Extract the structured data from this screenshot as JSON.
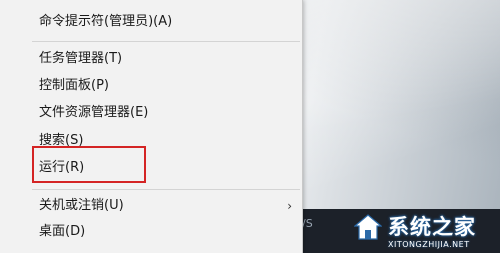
{
  "menu": {
    "items": [
      {
        "label": "命令提示符(管理员)(A)"
      },
      {
        "label": "任务管理器(T)"
      },
      {
        "label": "控制面板(P)"
      },
      {
        "label": "文件资源管理器(E)"
      },
      {
        "label": "搜索(S)"
      },
      {
        "label": "运行(R)"
      },
      {
        "label": "关机或注销(U)",
        "has_submenu": true
      },
      {
        "label": "桌面(D)"
      }
    ],
    "highlighted_item": "运行(R)",
    "highlight_color": "#d42424"
  },
  "taskbar": {
    "partial_text": "/S"
  },
  "watermark": {
    "name": "系统之家",
    "url": "XITONGZHIJIA.NET"
  },
  "icons": {
    "submenu_arrow": "chevron-right-icon",
    "start": "windows-logo-icon",
    "watermark_logo": "house-logo-icon"
  }
}
